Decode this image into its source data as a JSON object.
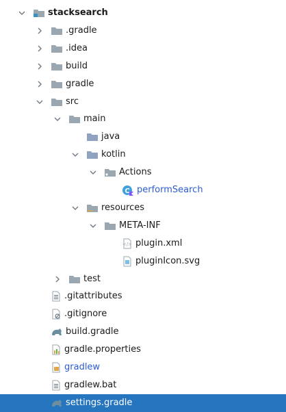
{
  "tree": [
    {
      "label": "stacksearch",
      "depth": 0,
      "arrow": "down",
      "icon": "module-folder-icon",
      "bold": true
    },
    {
      "label": ".gradle",
      "depth": 1,
      "arrow": "right",
      "icon": "folder-icon"
    },
    {
      "label": ".idea",
      "depth": 1,
      "arrow": "right",
      "icon": "folder-icon"
    },
    {
      "label": "build",
      "depth": 1,
      "arrow": "right",
      "icon": "folder-icon"
    },
    {
      "label": "gradle",
      "depth": 1,
      "arrow": "right",
      "icon": "folder-icon"
    },
    {
      "label": "src",
      "depth": 1,
      "arrow": "down",
      "icon": "folder-icon"
    },
    {
      "label": "main",
      "depth": 2,
      "arrow": "down",
      "icon": "folder-icon"
    },
    {
      "label": "java",
      "depth": 3,
      "arrow": "none",
      "icon": "source-folder-icon"
    },
    {
      "label": "kotlin",
      "depth": 3,
      "arrow": "down",
      "icon": "source-folder-icon"
    },
    {
      "label": "Actions",
      "depth": 4,
      "arrow": "down",
      "icon": "package-icon"
    },
    {
      "label": "performSearch",
      "depth": 5,
      "arrow": "none",
      "icon": "kotlin-class-icon",
      "blue": true
    },
    {
      "label": "resources",
      "depth": 3,
      "arrow": "down",
      "icon": "resources-folder-icon"
    },
    {
      "label": "META-INF",
      "depth": 4,
      "arrow": "down",
      "icon": "folder-icon"
    },
    {
      "label": "plugin.xml",
      "depth": 5,
      "arrow": "none",
      "icon": "xml-file-icon"
    },
    {
      "label": "pluginIcon.svg",
      "depth": 5,
      "arrow": "none",
      "icon": "svg-file-icon"
    },
    {
      "label": "test",
      "depth": 2,
      "arrow": "right",
      "icon": "folder-icon"
    },
    {
      "label": ".gitattributes",
      "depth": 1,
      "arrow": "none",
      "icon": "text-file-icon"
    },
    {
      "label": ".gitignore",
      "depth": 1,
      "arrow": "none",
      "icon": "ignore-file-icon"
    },
    {
      "label": "build.gradle",
      "depth": 1,
      "arrow": "none",
      "icon": "gradle-icon"
    },
    {
      "label": "gradle.properties",
      "depth": 1,
      "arrow": "none",
      "icon": "properties-file-icon"
    },
    {
      "label": "gradlew",
      "depth": 1,
      "arrow": "none",
      "icon": "script-file-icon",
      "blue": true
    },
    {
      "label": "gradlew.bat",
      "depth": 1,
      "arrow": "none",
      "icon": "text-file-icon"
    },
    {
      "label": "settings.gradle",
      "depth": 1,
      "arrow": "none",
      "icon": "gradle-icon",
      "selected": true
    }
  ],
  "colors": {
    "selection": "#2675bf",
    "folder": "#9aa7b0",
    "module_accent": "#3592c4",
    "kotlin": "#7f52ff",
    "link_blue": "#2a5bd7"
  }
}
